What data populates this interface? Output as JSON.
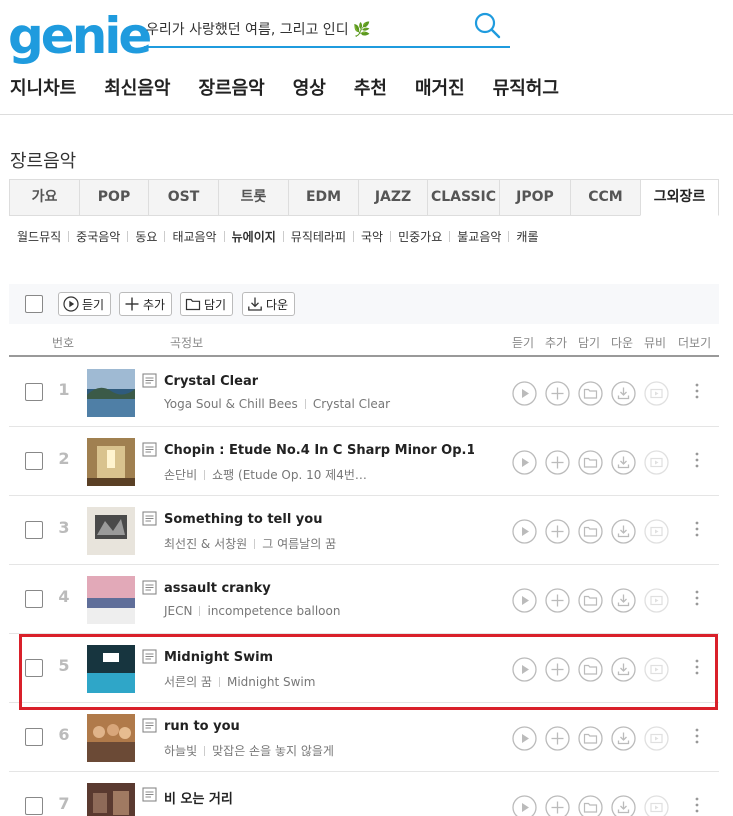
{
  "brand": {
    "logo_text": "genie",
    "color": "#1f9bde"
  },
  "search": {
    "value": "우리가 사랑했던 여름, 그리고 인디 🌿"
  },
  "gnb": [
    "지니차트",
    "최신음악",
    "장르음악",
    "영상",
    "추천",
    "매거진",
    "뮤직허그"
  ],
  "page_title": "장르음악",
  "genre_tabs": [
    "가요",
    "POP",
    "OST",
    "트롯",
    "EDM",
    "JAZZ",
    "CLASSIC",
    "JPOP",
    "CCM",
    "그외장르"
  ],
  "active_tab": "그외장르",
  "subgenres": [
    "월드뮤직",
    "중국음악",
    "동요",
    "태교음악",
    "뉴에이지",
    "뮤직테라피",
    "국악",
    "민중가요",
    "불교음악",
    "캐롤"
  ],
  "active_subgenre": "뉴에이지",
  "toolbar": {
    "listen": "듣기",
    "add": "추가",
    "save": "담기",
    "download": "다운"
  },
  "columns": {
    "number": "번호",
    "song_info": "곡정보",
    "listen": "듣기",
    "add": "추가",
    "save": "담기",
    "download": "다운",
    "mv": "뮤비",
    "more": "더보기"
  },
  "songs": [
    {
      "rank": "1",
      "title": "Crystal Clear",
      "artist": "Yoga Soul & Chill Bees",
      "album": "Crystal Clear"
    },
    {
      "rank": "2",
      "title": "Chopin : Etude No.4 In C Sharp Minor Op.10…",
      "artist": "손단비",
      "album": "쇼팽 (Etude Op. 10 제4번…"
    },
    {
      "rank": "3",
      "title": "Something to tell you",
      "artist": "최선진 & 서창원",
      "album": "그 여름날의 꿈"
    },
    {
      "rank": "4",
      "title": "assault cranky",
      "artist": "JECN",
      "album": "incompetence balloon"
    },
    {
      "rank": "5",
      "title": "Midnight Swim",
      "artist": "서른의 꿈",
      "album": "Midnight Swim"
    },
    {
      "rank": "6",
      "title": "run to you",
      "artist": "하늘빛",
      "album": "맞잡은 손을 놓지 않을게"
    },
    {
      "rank": "7",
      "title": "비 오는 거리",
      "artist": "",
      "album": ""
    }
  ],
  "highlight_color": "#d9202a"
}
